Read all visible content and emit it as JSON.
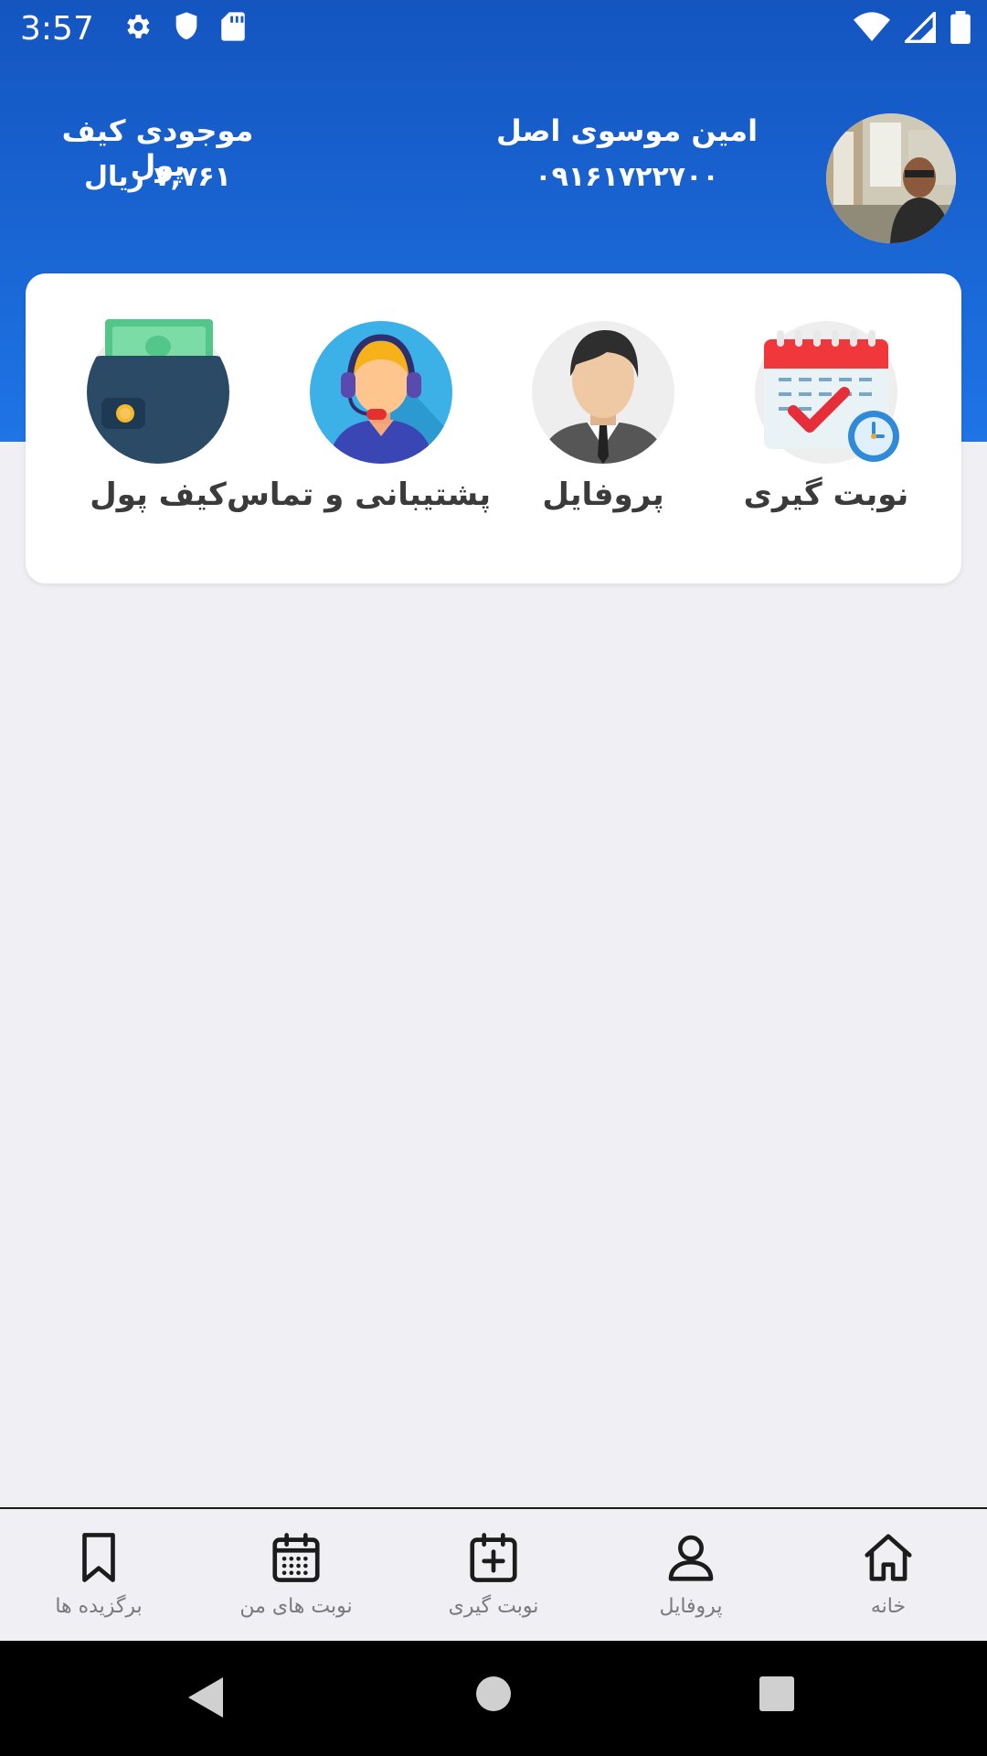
{
  "status_bar": {
    "time": "3:57",
    "left_icons": [
      "gear-icon",
      "shield-icon",
      "sd-card-icon"
    ],
    "right_icons": [
      "wifi-icon",
      "signal-icon",
      "battery-icon"
    ]
  },
  "header": {
    "user_name": "امین موسوی اصل",
    "user_phone": "۰۹۱۶۱۷۲۲۷۰۰",
    "wallet_title": "موجودی کیف پول",
    "wallet_balance": "۷,۷۶۱ ریال"
  },
  "quick_actions": [
    {
      "label": "نوبت گیری",
      "icon": "calendar-check-icon"
    },
    {
      "label": "پروفایل",
      "icon": "businessman-avatar-icon"
    },
    {
      "label": "پشتیبانی و تماس",
      "icon": "support-agent-icon"
    },
    {
      "label": "کیف پول",
      "icon": "wallet-money-icon"
    }
  ],
  "bottom_nav": [
    {
      "label": "خانه",
      "icon": "home-icon"
    },
    {
      "label": "پروفایل",
      "icon": "user-icon"
    },
    {
      "label": "نوبت گیری",
      "icon": "calendar-plus-icon"
    },
    {
      "label": "نوبت های من",
      "icon": "calendar-grid-icon"
    },
    {
      "label": "برگزیده ها",
      "icon": "bookmark-icon"
    }
  ],
  "colors": {
    "header_blue": "#1a67d6",
    "page_bg": "#efeff4",
    "card_bg": "#ffffff",
    "nav_label": "#7a7a7a"
  }
}
